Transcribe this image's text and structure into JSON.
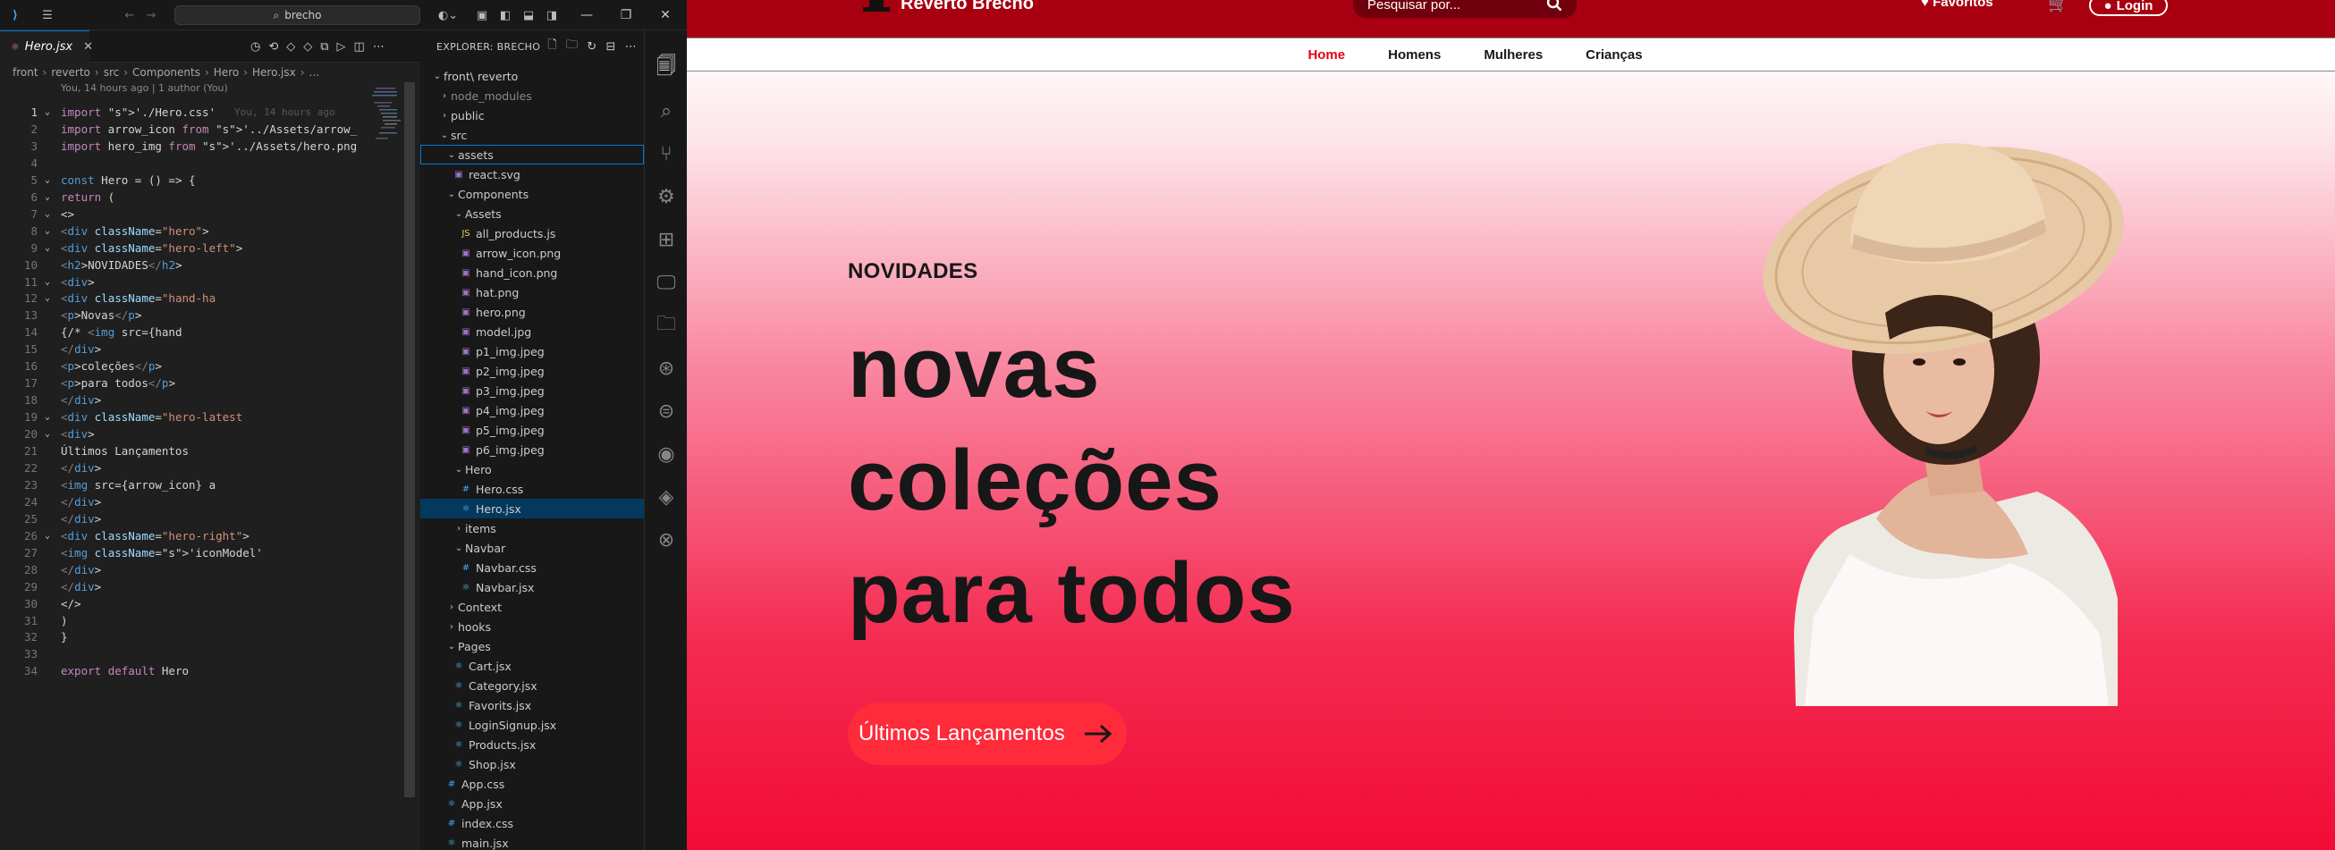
{
  "vscode": {
    "search": "brecho",
    "tab": "Hero.jsx",
    "explorer_title": "EXPLORER: BRECHO",
    "breadcrumb": [
      "front",
      "reverto",
      "src",
      "Components",
      "Hero",
      "Hero.jsx",
      "..."
    ],
    "blame": "You, 14 hours ago | 1 author (You)",
    "inline_blame": "You, 14 hours ago",
    "code": [
      "import './Hero.css'",
      "import arrow_icon from '../Assets/arrow_icon",
      "import hero_img from '../Assets/hero.png'",
      "",
      "const Hero = () => {",
      "  return (",
      "    <>",
      "      <div className=\"hero\">",
      "        <div className=\"hero-left\">",
      "          <h2>NOVIDADES</h2>",
      "          <div>",
      "            <div className=\"hand-ha",
      "              <p>Novas</p>",
      "              {/* <img  src={hand",
      "            </div>",
      "            <p>coleções</p>",
      "            <p>para todos</p>",
      "          </div>",
      "          <div className=\"hero-latest",
      "            <div>",
      "              Últimos Lançamentos",
      "            </div>",
      "            <img src={arrow_icon} a",
      "          </div>",
      "        </div>",
      "        <div className=\"hero-right\">",
      "          <img className='iconModel'",
      "        </div>",
      "      </div>",
      "    </>",
      "  )",
      "}",
      "",
      "export default Hero"
    ],
    "tree": [
      {
        "label": "front\\ reverto",
        "chev": "⌄",
        "depth": 0
      },
      {
        "label": "node_modules",
        "chev": "›",
        "depth": 1,
        "muted": true
      },
      {
        "label": "public",
        "chev": "›",
        "depth": 1
      },
      {
        "label": "src",
        "chev": "⌄",
        "depth": 1
      },
      {
        "label": "assets",
        "chev": "⌄",
        "depth": 2
      },
      {
        "label": "react.svg",
        "icon": "img",
        "depth": 3
      },
      {
        "label": "Components",
        "chev": "⌄",
        "depth": 2
      },
      {
        "label": "Assets",
        "chev": "⌄",
        "depth": 3
      },
      {
        "label": "all_products.js",
        "icon": "js",
        "depth": 4
      },
      {
        "label": "arrow_icon.png",
        "icon": "img",
        "depth": 4
      },
      {
        "label": "hand_icon.png",
        "icon": "img",
        "depth": 4
      },
      {
        "label": "hat.png",
        "icon": "img",
        "depth": 4
      },
      {
        "label": "hero.png",
        "icon": "img",
        "depth": 4
      },
      {
        "label": "model.jpg",
        "icon": "img",
        "depth": 4
      },
      {
        "label": "p1_img.jpeg",
        "icon": "img",
        "depth": 4
      },
      {
        "label": "p2_img.jpeg",
        "icon": "img",
        "depth": 4
      },
      {
        "label": "p3_img.jpeg",
        "icon": "img",
        "depth": 4
      },
      {
        "label": "p4_img.jpeg",
        "icon": "img",
        "depth": 4
      },
      {
        "label": "p5_img.jpeg",
        "icon": "img",
        "depth": 4
      },
      {
        "label": "p6_img.jpeg",
        "icon": "img",
        "depth": 4
      },
      {
        "label": "Hero",
        "chev": "⌄",
        "depth": 3
      },
      {
        "label": "Hero.css",
        "icon": "css",
        "depth": 4
      },
      {
        "label": "Hero.jsx",
        "icon": "jsx",
        "depth": 4
      },
      {
        "label": "items",
        "chev": "›",
        "depth": 3
      },
      {
        "label": "Navbar",
        "chev": "⌄",
        "depth": 3
      },
      {
        "label": "Navbar.css",
        "icon": "css",
        "depth": 4
      },
      {
        "label": "Navbar.jsx",
        "icon": "jsx",
        "depth": 4
      },
      {
        "label": "Context",
        "chev": "›",
        "depth": 2
      },
      {
        "label": "hooks",
        "chev": "›",
        "depth": 2
      },
      {
        "label": "Pages",
        "chev": "⌄",
        "depth": 2
      },
      {
        "label": "Cart.jsx",
        "icon": "jsx",
        "depth": 3
      },
      {
        "label": "Category.jsx",
        "icon": "jsx",
        "depth": 3
      },
      {
        "label": "Favorits.jsx",
        "icon": "jsx",
        "depth": 3
      },
      {
        "label": "LoginSignup.jsx",
        "icon": "jsx",
        "depth": 3
      },
      {
        "label": "Products.jsx",
        "icon": "jsx",
        "depth": 3
      },
      {
        "label": "Shop.jsx",
        "icon": "jsx",
        "depth": 3
      },
      {
        "label": "App.css",
        "icon": "css",
        "depth": 2
      },
      {
        "label": "App.jsx",
        "icon": "jsx",
        "depth": 2
      },
      {
        "label": "index.css",
        "icon": "css",
        "depth": 2
      },
      {
        "label": "main.jsx",
        "icon": "jsx",
        "depth": 2
      }
    ]
  },
  "site": {
    "brand": "Reverto Brechó",
    "search_placeholder": "Pesquisar por...",
    "favorites": "Favoritos",
    "login": "Login",
    "nav": [
      "Home",
      "Homens",
      "Mulheres",
      "Crianças"
    ],
    "hero": {
      "kicker": "NOVIDADES",
      "line1": "novas",
      "line2": "coleções",
      "line3": "para todos",
      "button": "Últimos Lançamentos"
    }
  }
}
